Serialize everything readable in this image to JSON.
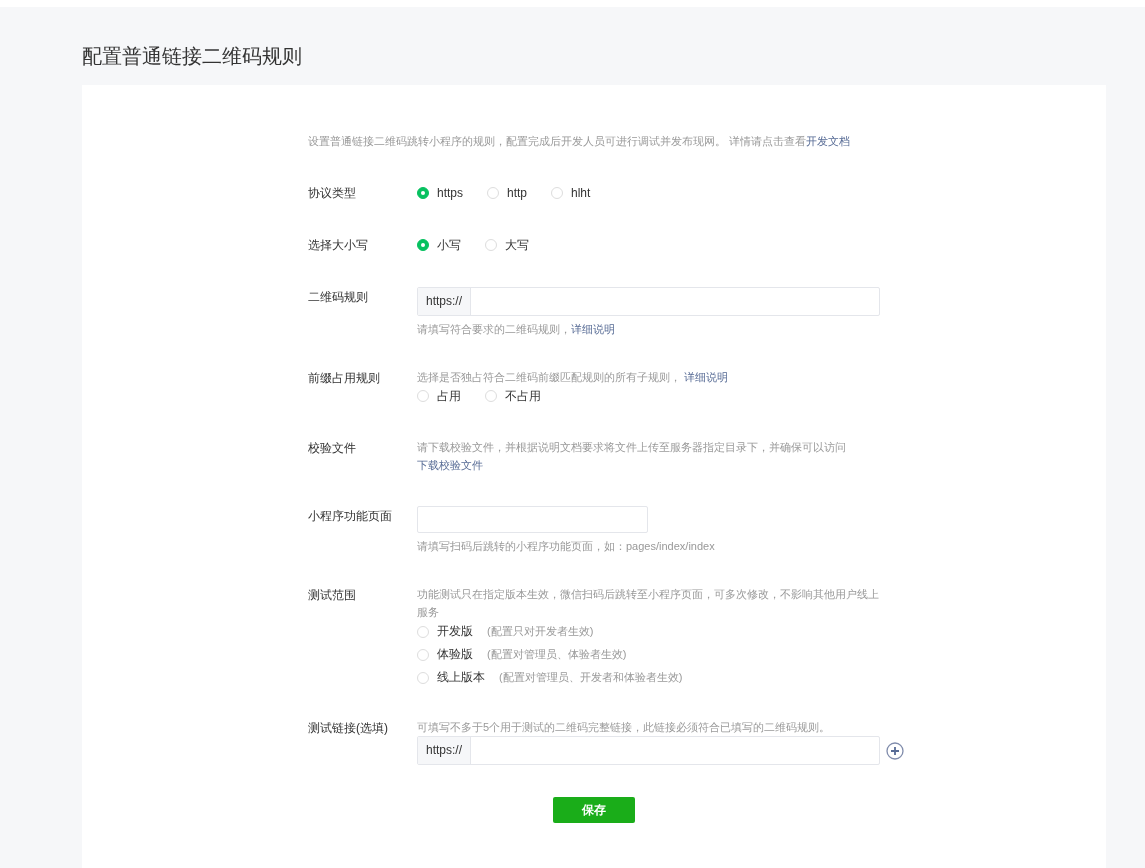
{
  "page_title": "配置普通链接二维码规则",
  "intro": {
    "text": "设置普通链接二维码跳转小程序的规则，配置完成后开发人员可进行调试并发布现网。 详情请点击查看",
    "link": "开发文档"
  },
  "fields": [
    {
      "kind": "radio",
      "label": "协议类型",
      "options": [
        {
          "label": "https",
          "selected": true
        },
        {
          "label": "http",
          "selected": false
        },
        {
          "label": "hlht",
          "selected": false
        }
      ]
    },
    {
      "kind": "radio",
      "label": "选择大小写",
      "options": [
        {
          "label": "小写",
          "selected": true
        },
        {
          "label": "大写",
          "selected": false
        }
      ]
    },
    {
      "kind": "prefix_input",
      "label": "二维码规则",
      "prefix": "https://",
      "hint": "请填写符合要求的二维码规则，",
      "hint_link": "详细说明"
    },
    {
      "kind": "radio",
      "label": "前缀占用规则",
      "description": "选择是否独占符合二维码前缀匹配规则的所有子规则， ",
      "description_link": "详细说明",
      "options": [
        {
          "label": "占用",
          "selected": false
        },
        {
          "label": "不占用",
          "selected": false
        }
      ]
    },
    {
      "kind": "text",
      "label": "校验文件",
      "description": "请下载校验文件，并根据说明文档要求将文件上传至服务器指定目录下，并确保可以访问",
      "link": "下载校验文件"
    },
    {
      "kind": "input",
      "label": "小程序功能页面",
      "hint": "请填写扫码后跳转的小程序功能页面，如：pages/index/index"
    },
    {
      "kind": "radio_list",
      "label": "测试范围",
      "description": "功能测试只在指定版本生效，微信扫码后跳转至小程序页面，可多次修改，不影响其他用户线上服务",
      "options": [
        {
          "label": "开发版",
          "note": "(配置只对开发者生效)",
          "selected": false
        },
        {
          "label": "体验版",
          "note": "(配置对管理员、体验者生效)",
          "selected": false
        },
        {
          "label": "线上版本",
          "note": "(配置对管理员、开发者和体验者生效)",
          "selected": false
        }
      ]
    },
    {
      "kind": "prefix_input",
      "label": "测试链接(选填)",
      "description": "可填写不多于5个用于测试的二维码完整链接，此链接必须符合已填写的二维码规则。",
      "prefix": "https://",
      "add_button": true
    }
  ],
  "save_button": "保存"
}
